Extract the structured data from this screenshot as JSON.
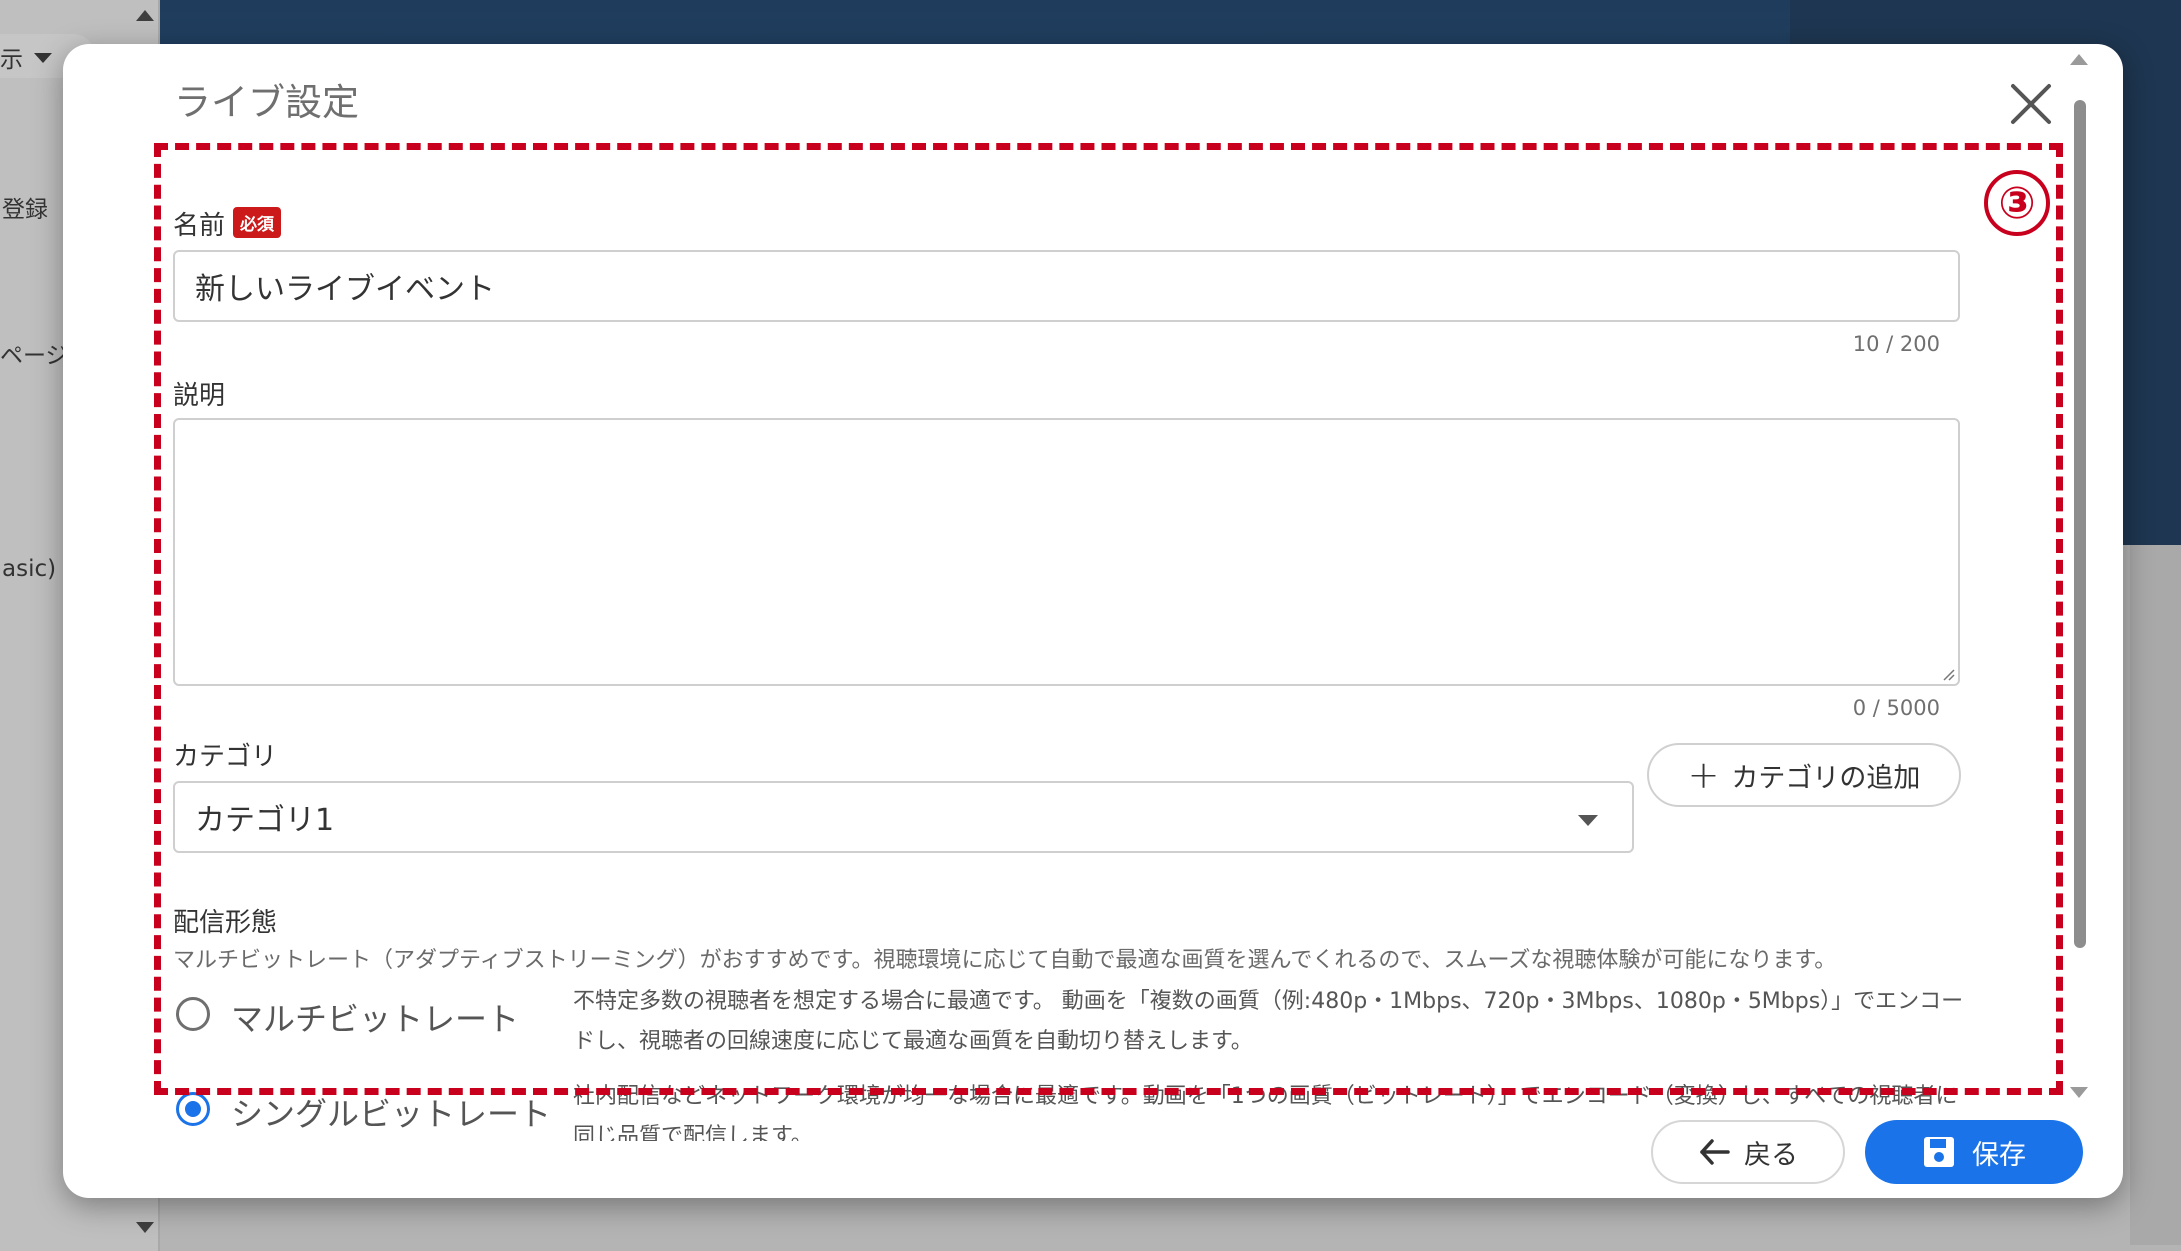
{
  "background": {
    "left_texts": [
      "示",
      "登録",
      "ページ",
      "asic)"
    ]
  },
  "dialog": {
    "title": "ライブ設定",
    "name_field": {
      "label": "名前",
      "required_badge": "必須",
      "value": "新しいライブイベント",
      "counter": "10 / 200"
    },
    "description_field": {
      "label": "説明",
      "value": "",
      "counter": "0 / 5000"
    },
    "category_field": {
      "label": "カテゴリ",
      "selected": "カテゴリ1",
      "add_button": "カテゴリの追加"
    },
    "delivery": {
      "label": "配信形態",
      "description": "マルチビットレート（アダプティブストリーミング）がおすすめです。視聴環境に応じて自動で最適な画質を選んでくれるので、スムーズな視聴体験が可能になります。",
      "options": [
        {
          "label": "マルチビットレート",
          "selected": false,
          "desc": "不特定多数の視聴者を想定する場合に最適です。 動画を「複数の画質（例:480p・1Mbps、720p・3Mbps、1080p・5Mbps）」でエンコードし、視聴者の回線速度に応じて最適な画質を自動切り替えします。"
        },
        {
          "label": "シングルビットレート",
          "selected": true,
          "desc": "社内配信などネットワーク環境が均一な場合に最適です。動画を「1つの画質（ビットレート）」でエンコード（変換）し、すべての視聴者に同じ品質で配信します。"
        }
      ]
    },
    "annotation_marker": "③",
    "footer": {
      "back_label": "戻る",
      "save_label": "保存"
    }
  },
  "colors": {
    "accent": "#1a73e8",
    "annotation": "#c8001e",
    "required_badge": "#cc1a1a"
  }
}
